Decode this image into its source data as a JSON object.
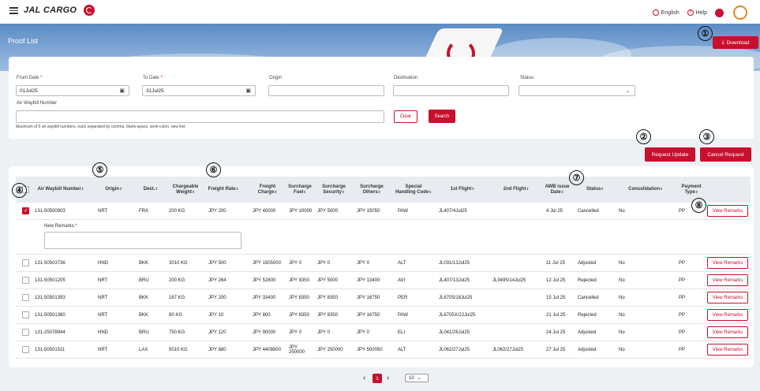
{
  "header": {
    "logo_text": "JAL CARGO",
    "language": "English",
    "help": "Help"
  },
  "banner": {
    "title": "Proof List",
    "download_label": "Download"
  },
  "filters": {
    "from_date_label": "From Date",
    "from_date_value": "01Jul25",
    "to_date_label": "To Date",
    "to_date_value": "31Jul25",
    "origin_label": "Origin",
    "origin_value": "",
    "destination_label": "Destination",
    "destination_value": "",
    "status_label": "Status",
    "status_value": "",
    "awb_label": "Air Waybill Number",
    "awb_value": "",
    "hint": "Maximum of 5 air waybill numbers, each separated by comma, blank-space, semi-colon, new line",
    "required_mark": "*",
    "clear_label": "Clear",
    "search_label": "Search"
  },
  "actions": {
    "request_update": "Request Update",
    "cancel_request": "Cancel Request"
  },
  "table": {
    "columns": [
      "Air Waybill Number",
      "Origin",
      "Dest.",
      "Chargeable Weight",
      "Freight Rate",
      "Freight Charge",
      "Surcharge Fuel",
      "Surcharge Security",
      "Surcharge Others",
      "Special Handling Code",
      "1st Flight",
      "2nd Flight",
      "AWB issue Date",
      "Status",
      "Consolidation",
      "Payment Type"
    ],
    "sort_icon": "⇕",
    "view_remarks_label": "View Remarks",
    "new_remarks_label": "New Remarks:",
    "rows": [
      [
        "131-50500903",
        "NRT",
        "FRA",
        "200 KG",
        "JPY 200",
        "JPY 40000",
        "JPY 10000",
        "JPY 5000",
        "JPY 15050",
        "PAW",
        "JL407/4Jul25",
        "",
        "4 Jul 25",
        "Cancelled",
        "No",
        "PP"
      ],
      [
        "131-50503736",
        "HND",
        "BKK",
        "3010 KG",
        "JPY 500",
        "JPY 1505000",
        "JPY 0",
        "JPY 0",
        "JPY 0",
        "ALT",
        "JL031/13Jul25",
        "",
        "11 Jul 25",
        "Adjusted",
        "No",
        "PP"
      ],
      [
        "131-50501205",
        "NRT",
        "BRU",
        "200 KG",
        "JPY 264",
        "JPY 52800",
        "JPY 8350",
        "JPY 5000",
        "JPY 13400",
        "AVI",
        "JL407/13Jul25",
        "JL9495/14Jul25",
        "12 Jul 25",
        "Rejected",
        "No",
        "PP"
      ],
      [
        "131-50501393",
        "NRT",
        "BKK",
        "167 KG",
        "JPY 200",
        "JPY 33400",
        "JPY 8350",
        "JPY 8350",
        "JPY 16750",
        "PER",
        "JL6705/18Jul25",
        "",
        "15 Jul 25",
        "Cancelled",
        "No",
        "PP"
      ],
      [
        "131-50501360",
        "NRT",
        "BKK",
        "80 KG",
        "JPY 10",
        "JPY 800",
        "JPY 8350",
        "JPY 8350",
        "JPY 16750",
        "PAW",
        "JL6705X/22Jul25",
        "",
        "21 Jul 25",
        "Rejected",
        "No",
        "PP"
      ],
      [
        "131-25078944",
        "HND",
        "BRU",
        "750 KG",
        "JPY 120",
        "JPY 90000",
        "JPY 0",
        "JPY 0",
        "JPY 0",
        "ELI",
        "JL041/26Jul25",
        "",
        "24 Jul 25",
        "Adjusted",
        "No",
        "PP"
      ],
      [
        "131-50501511",
        "NRT",
        "LAX",
        "5010 KG",
        "JPY 880",
        "JPY 4408800",
        "JPY 250000",
        "JPY 250000",
        "JPY 500050",
        "ALT",
        "JL062/27Jul25",
        "JL062/27Jul25",
        "27 Jul 25",
        "Adjusted",
        "No",
        "PP"
      ]
    ],
    "checked": [
      true,
      false,
      false,
      false,
      false,
      false,
      false
    ]
  },
  "pagination": {
    "current_page": "1",
    "page_size": "10",
    "prev": "‹",
    "next": "›"
  },
  "markers": [
    "①",
    "②",
    "③",
    "④",
    "⑤",
    "⑥",
    "⑦",
    "⑧"
  ],
  "colors": {
    "brand_red": "#c8102e",
    "header_bg": "#e8ecf0",
    "page_bg": "#eef1f4"
  }
}
